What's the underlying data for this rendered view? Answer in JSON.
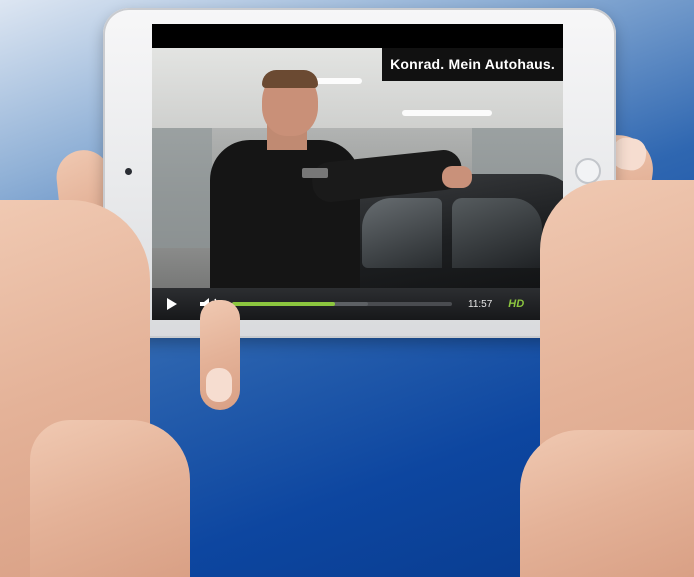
{
  "video_player": {
    "title": "Konrad. Mein Autohaus.",
    "duration": "11:57",
    "quality": "HD",
    "progress_fraction": 0.47,
    "buffered_fraction": 0.62,
    "accent_color": "#8cc63f"
  },
  "icons": {
    "play": "play-icon",
    "volume": "volume-icon",
    "fullscreen": "fullscreen-icon"
  }
}
